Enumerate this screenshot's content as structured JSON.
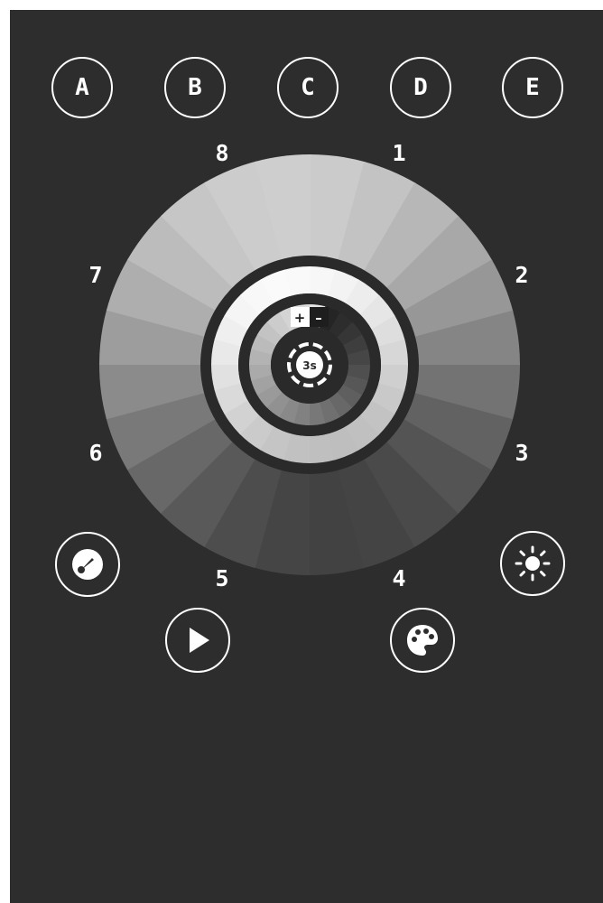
{
  "colors": {
    "background": "#2d2d2d",
    "foreground": "#ffffff",
    "ring_gap": "#2a2a2a"
  },
  "preset_buttons": [
    {
      "label": "A"
    },
    {
      "label": "B"
    },
    {
      "label": "C"
    },
    {
      "label": "D"
    },
    {
      "label": "E"
    }
  ],
  "zones": [
    {
      "label": "1"
    },
    {
      "label": "2"
    },
    {
      "label": "3"
    },
    {
      "label": "4"
    },
    {
      "label": "5"
    },
    {
      "label": "6"
    },
    {
      "label": "7"
    },
    {
      "label": "8"
    }
  ],
  "center": {
    "increase_label": "+",
    "decrease_label": "–",
    "timer_label": "3s"
  },
  "controls": {
    "speed_icon": "speedometer-icon",
    "brightness_icon": "sun-icon",
    "play_icon": "play-icon",
    "palette_icon": "palette-icon"
  }
}
